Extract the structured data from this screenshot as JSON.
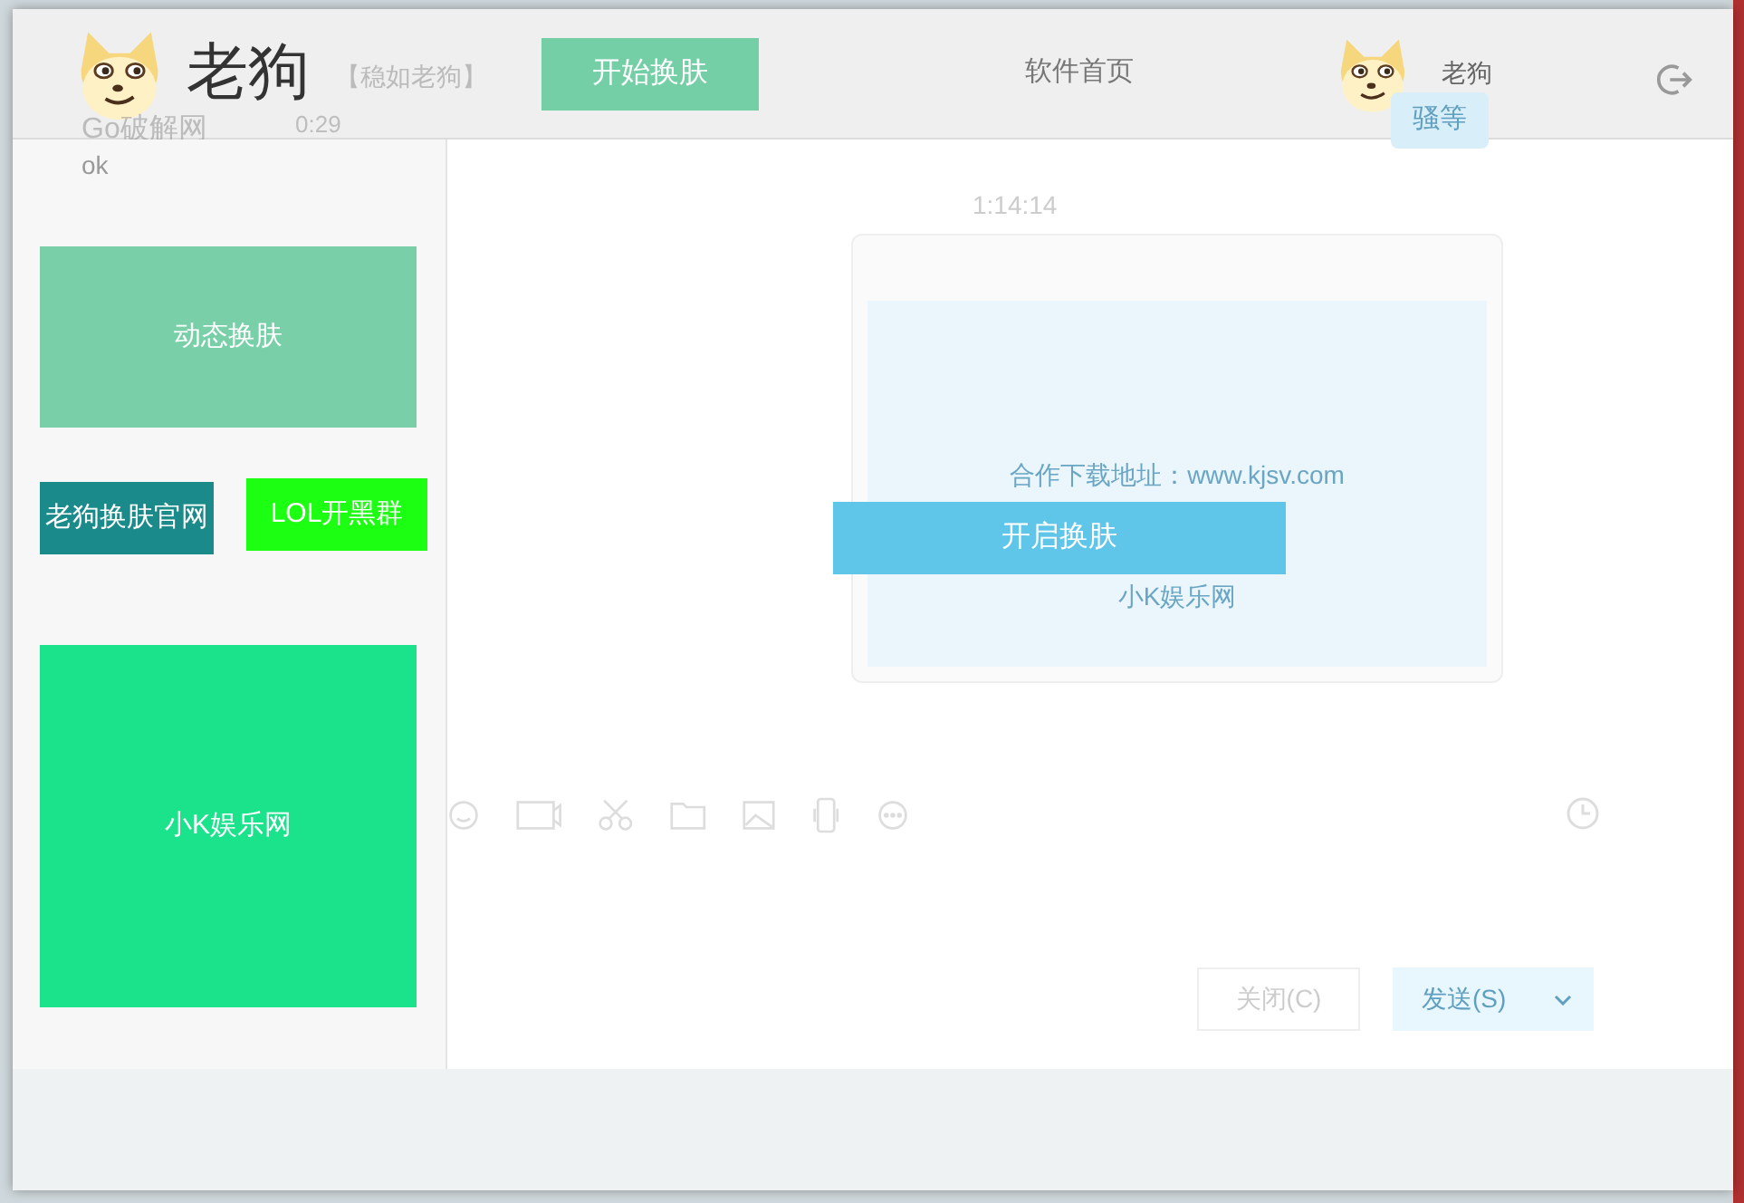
{
  "header": {
    "logo_title": "老狗",
    "tagline": "【稳如老狗】",
    "start_button": "开始换肤",
    "home_link": "软件首页",
    "username": "老狗"
  },
  "sidebar": {
    "tiles": [
      {
        "label": "动态换肤",
        "color": "#79d0a8"
      },
      {
        "label": "老狗换肤官网",
        "color": "#1b8a8a"
      },
      {
        "label": "LOL开黑群",
        "color": "#1cff13"
      },
      {
        "label": "小K娱乐网",
        "color": "#1ae38b"
      }
    ]
  },
  "chat_list": [
    {
      "name": "Go破解网",
      "time": "0:29",
      "preview": "ok"
    }
  ],
  "chat": {
    "timestamp": "1:14:14",
    "message": "骚等",
    "close_button": "关闭(C)",
    "send_button": "发送(S)"
  },
  "preview": {
    "download_text": "合作下载地址：www.kjsv.com",
    "site_text": "小K娱乐网"
  },
  "enable_button": "开启换肤"
}
